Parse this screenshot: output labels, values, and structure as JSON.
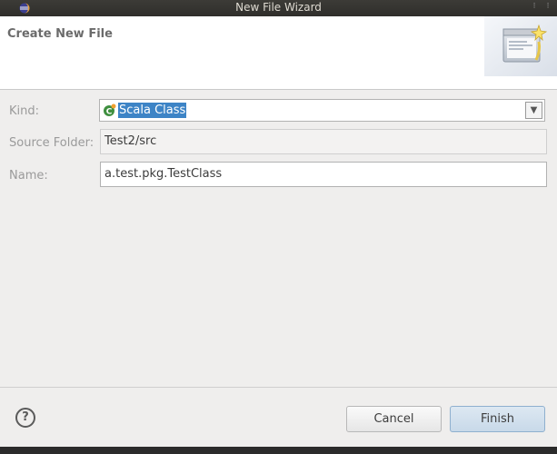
{
  "window": {
    "title": "New File Wizard",
    "minimize_glyph": "⁝",
    "close_glyph": "⁝"
  },
  "banner": {
    "title": "Create New File",
    "image_icon": "wizard-banner-icon"
  },
  "form": {
    "kind_label": "Kind:",
    "kind_value": "Scala Class",
    "kind_icon": "scala-class-icon",
    "kind_dropdown_glyph": "▼",
    "source_folder_label": "Source Folder:",
    "source_folder_value": "Test2/src",
    "name_label": "Name:",
    "name_value": "a.test.pkg.TestClass"
  },
  "footer": {
    "help_glyph": "?",
    "cancel_label": "Cancel",
    "finish_label": "Finish"
  },
  "colors": {
    "selection": "#3d84c6",
    "titlebar": "#3c3b37"
  }
}
